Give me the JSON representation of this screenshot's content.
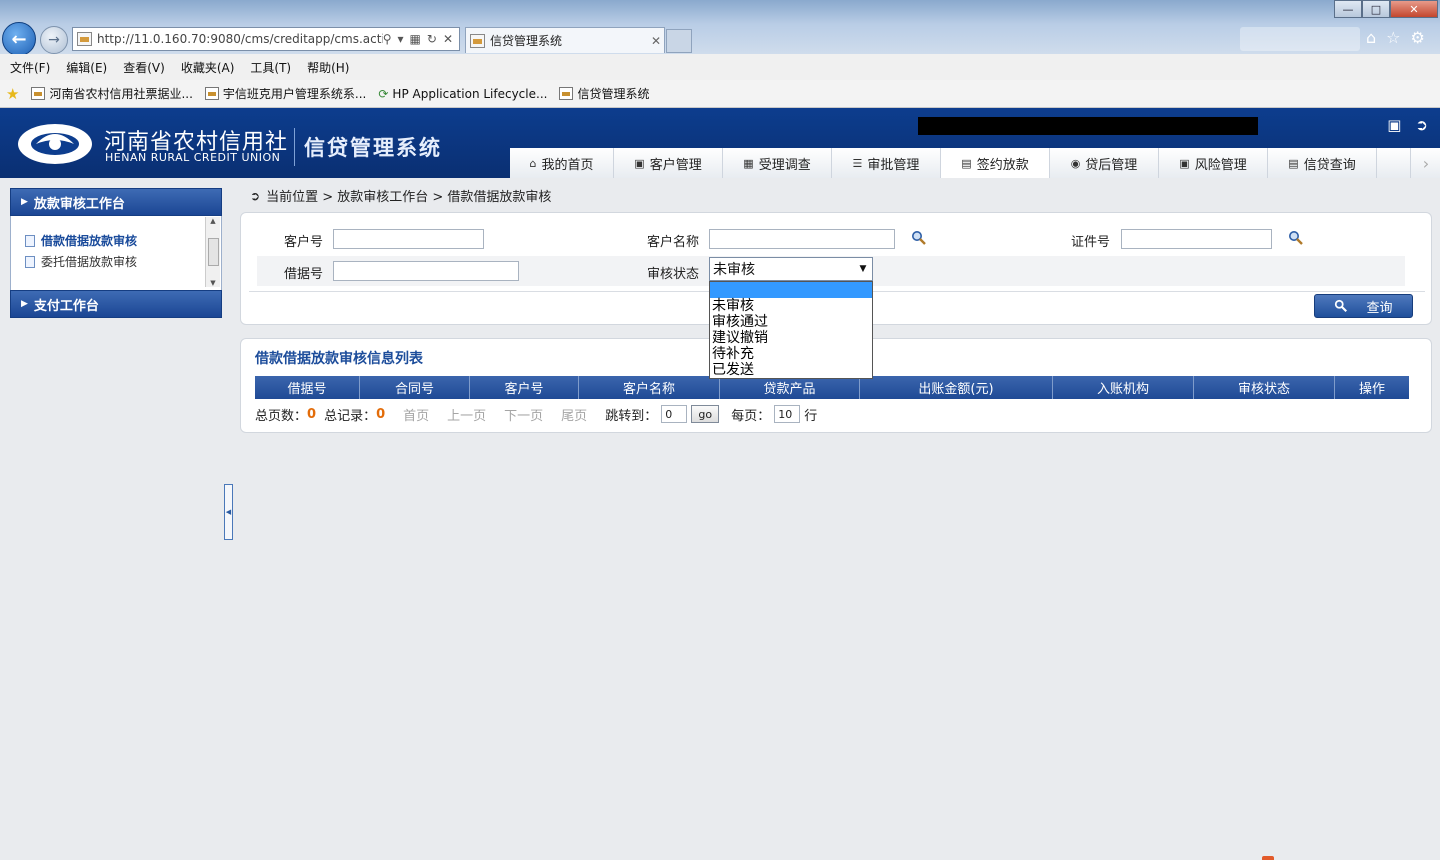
{
  "browser": {
    "url": "http://11.0.160.70:9080/cms/creditapp/cms.actic",
    "tab_title": "信贷管理系统",
    "menu": [
      "文件(F)",
      "编辑(E)",
      "查看(V)",
      "收藏夹(A)",
      "工具(T)",
      "帮助(H)"
    ],
    "favorites": [
      "河南省农村信用社票据业...",
      "宇信班克用户管理系统系...",
      "HP Application Lifecycle...",
      "信贷管理系统"
    ]
  },
  "header": {
    "logo_cn": "河南省农村信用社",
    "logo_en": "HENAN RURAL CREDIT UNION",
    "system_title": "信贷管理系统",
    "nav_tabs": [
      {
        "label": "我的首页",
        "icon": "home-icon"
      },
      {
        "label": "客户管理",
        "icon": "customer-icon"
      },
      {
        "label": "受理调查",
        "icon": "survey-icon"
      },
      {
        "label": "审批管理",
        "icon": "approval-icon"
      },
      {
        "label": "签约放款",
        "icon": "contract-icon",
        "active": true
      },
      {
        "label": "贷后管理",
        "icon": "postloan-icon"
      },
      {
        "label": "风险管理",
        "icon": "risk-icon"
      },
      {
        "label": "信贷查询",
        "icon": "query-icon"
      }
    ]
  },
  "sidebar": {
    "section1_title": "放款审核工作台",
    "items": [
      "借款借据放款审核",
      "委托借据放款审核"
    ],
    "section2_title": "支付工作台"
  },
  "breadcrumb": {
    "text": "当前位置 > 放款审核工作台 > 借款借据放款审核"
  },
  "search": {
    "customer_no_label": "客户号",
    "customer_name_label": "客户名称",
    "id_no_label": "证件号",
    "loan_no_label": "借据号",
    "audit_status_label": "审核状态",
    "audit_status_value": "未审核",
    "audit_status_options": [
      "",
      "未审核",
      "审核通过",
      "建议撤销",
      "待补充",
      "已发送"
    ],
    "query_button": "查询"
  },
  "list": {
    "title": "借款借据放款审核信息列表",
    "columns": [
      "借据号",
      "合同号",
      "客户号",
      "客户名称",
      "贷款产品",
      "出账金额(元)",
      "入账机构",
      "审核状态",
      "操作"
    ]
  },
  "pager": {
    "total_pages_label": "总页数：",
    "total_pages": "0",
    "total_records_label": "总记录：",
    "total_records": "0",
    "first": "首页",
    "prev": "上一页",
    "next": "下一页",
    "last": "尾页",
    "jump_label": "跳转到：",
    "jump_value": "0",
    "go": "go",
    "per_page_label": "每页：",
    "per_page_value": "10",
    "per_page_unit": "行"
  },
  "colors": {
    "header_blue": "#0d3d8e",
    "table_head_blue": "#2a549d",
    "highlight_blue": "#3399ff",
    "count_orange": "#e36c09"
  }
}
